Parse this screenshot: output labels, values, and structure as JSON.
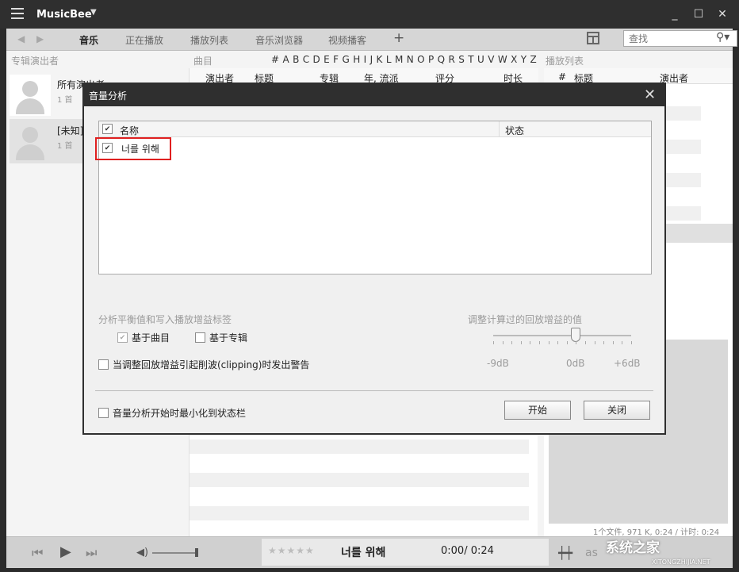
{
  "app": {
    "name": "MusicBee"
  },
  "toolbar": {
    "tabs": [
      "音乐",
      "正在播放",
      "播放列表",
      "音乐浏览器",
      "视频播客"
    ],
    "add_label": "+",
    "search_placeholder": "查找"
  },
  "columns": {
    "artists_header": "专辑演出者",
    "tracks_header": "曲目",
    "alphabet": "# A B C D E F G H I  J K L M N O P Q R S T U V W X Y Z",
    "playlist_header": "播放列表",
    "track_cols": [
      "演出者",
      "标题",
      "专辑",
      "年, 流派",
      "评分",
      "时长"
    ],
    "playlist_cols": [
      "#",
      "标题",
      "演出者"
    ]
  },
  "artists": [
    {
      "name": "所有演出者",
      "count": "1 首"
    },
    {
      "name": "[未知]",
      "count": "1 首"
    }
  ],
  "dialog": {
    "title": "音量分析",
    "list_header_name": "名称",
    "list_header_status": "状态",
    "files": [
      {
        "name": "너를 위해",
        "checked": true,
        "status": ""
      }
    ],
    "section_write_label": "分析平衡值和写入播放增益标签",
    "opt_track": "基于曲目",
    "opt_album": "基于专辑",
    "opt_clipping": "当调整回放增益引起削波(clipping)时发出警告",
    "adjust_label": "调整计算过的回放增益的值",
    "slider_min": "-9dB",
    "slider_mid": "0dB",
    "slider_max": "+6dB",
    "slider_value_db": 0,
    "opt_minimize": "音量分析开始时最小化到状态栏",
    "start_button": "开始",
    "close_button": "关闭"
  },
  "status": {
    "info": "1个文件, 971 K, 0:24 /  计时: 0:24"
  },
  "player": {
    "stars": "★★★★★",
    "title": "너를 위해",
    "time": "0:00/ 0:24"
  },
  "watermark": {
    "main": "系统之家",
    "sub": "XITONGZHIJIA.NET"
  }
}
